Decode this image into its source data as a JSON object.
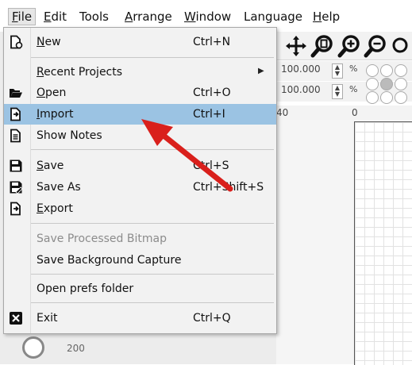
{
  "menubar": {
    "items": [
      {
        "label": "File",
        "mnemonic": "F",
        "rest": "ile"
      },
      {
        "label": "Edit",
        "mnemonic": "E",
        "rest": "dit"
      },
      {
        "label": "Tools",
        "mnemonic": "",
        "rest": "Tools"
      },
      {
        "label": "Arrange",
        "mnemonic": "A",
        "rest": "rrange"
      },
      {
        "label": "Window",
        "mnemonic": "W",
        "rest": "indow"
      },
      {
        "label": "Language",
        "mnemonic": "",
        "rest": "Language"
      },
      {
        "label": "Help",
        "mnemonic": "H",
        "rest": "elp"
      }
    ]
  },
  "toolbar": {
    "icons": [
      "move-icon",
      "zoom-page-icon",
      "zoom-in-icon",
      "zoom-out-icon"
    ]
  },
  "size_fields": [
    {
      "value": "100.000",
      "unit": "%"
    },
    {
      "value": "100.000",
      "unit": "%"
    }
  ],
  "ruler": {
    "top_labels": [
      "40",
      "0"
    ],
    "bottom_label": "200"
  },
  "file_menu": {
    "items": [
      {
        "id": "new",
        "mnemonic": "N",
        "rest": "ew",
        "shortcut": "Ctrl+N",
        "icon": "new-file-icon"
      },
      {
        "id": "recent",
        "mnemonic": "R",
        "rest": "ecent Projects",
        "shortcut": "",
        "icon": "",
        "submenu": true
      },
      {
        "id": "open",
        "mnemonic": "O",
        "rest": "pen",
        "shortcut": "Ctrl+O",
        "icon": "folder-open-icon"
      },
      {
        "id": "import",
        "mnemonic": "I",
        "rest": "mport",
        "shortcut": "Ctrl+I",
        "icon": "import-icon",
        "highlighted": true
      },
      {
        "id": "show-notes",
        "mnemonic": "",
        "rest": "Show Notes",
        "shortcut": "",
        "icon": "notes-icon"
      },
      {
        "id": "save",
        "mnemonic": "S",
        "rest": "ave",
        "shortcut": "Ctrl+S",
        "icon": "save-icon"
      },
      {
        "id": "save-as",
        "mnemonic": "",
        "rest": "Save As",
        "shortcut": "Ctrl+Shift+S",
        "icon": "save-as-icon"
      },
      {
        "id": "export",
        "mnemonic": "E",
        "rest": "xport",
        "shortcut": "",
        "icon": "export-icon"
      },
      {
        "id": "save-processed",
        "mnemonic": "",
        "rest": "Save Processed Bitmap",
        "shortcut": "",
        "icon": "",
        "disabled": true
      },
      {
        "id": "save-background",
        "mnemonic": "",
        "rest": "Save Background Capture",
        "shortcut": "",
        "icon": ""
      },
      {
        "id": "open-prefs",
        "mnemonic": "",
        "rest": "Open prefs folder",
        "shortcut": "",
        "icon": ""
      },
      {
        "id": "exit",
        "mnemonic": "",
        "rest": "Exit",
        "shortcut": "Ctrl+Q",
        "icon": "exit-icon"
      }
    ]
  },
  "colors": {
    "highlight": "#9bc3e3",
    "annotation_arrow": "#d9201c",
    "menu_bg": "#f2f2f2"
  }
}
